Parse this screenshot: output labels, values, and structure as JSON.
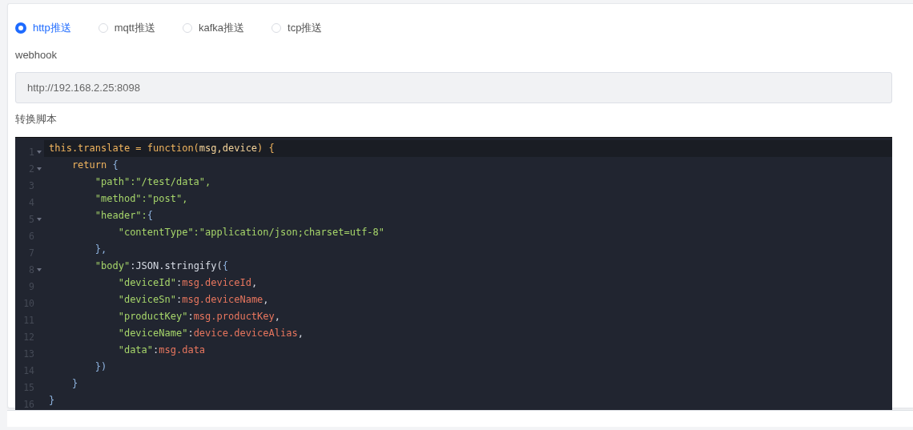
{
  "push_types": [
    {
      "label": "http推送",
      "selected": true
    },
    {
      "label": "mqtt推送",
      "selected": false
    },
    {
      "label": "kafka推送",
      "selected": false
    },
    {
      "label": "tcp推送",
      "selected": false
    }
  ],
  "webhook": {
    "label": "webhook",
    "value": "http://192.168.2.25:8098"
  },
  "script": {
    "label": "转换脚本",
    "lines": [
      {
        "number": "1",
        "foldable": true,
        "active": true,
        "tokens": [
          {
            "kind": "kw",
            "text": "this.translate = function("
          },
          {
            "kind": "arg",
            "text": "msg,device"
          },
          {
            "kind": "kw",
            "text": ") {"
          }
        ]
      },
      {
        "number": "2",
        "foldable": true,
        "active": false,
        "tokens": [
          {
            "kind": "kw",
            "text": "    return "
          },
          {
            "kind": "punc",
            "text": "{"
          }
        ]
      },
      {
        "number": "3",
        "foldable": false,
        "active": false,
        "tokens": [
          {
            "kind": "str",
            "text": "        \"path\":\"/test/data\","
          }
        ]
      },
      {
        "number": "4",
        "foldable": false,
        "active": false,
        "tokens": [
          {
            "kind": "str",
            "text": "        \"method\":\"post\","
          }
        ]
      },
      {
        "number": "5",
        "foldable": true,
        "active": false,
        "tokens": [
          {
            "kind": "str",
            "text": "        \"header\":"
          },
          {
            "kind": "punc",
            "text": "{"
          }
        ]
      },
      {
        "number": "6",
        "foldable": false,
        "active": false,
        "tokens": [
          {
            "kind": "str",
            "text": "            \"contentType\":\"application/json;charset=utf-8\""
          }
        ]
      },
      {
        "number": "7",
        "foldable": false,
        "active": false,
        "tokens": [
          {
            "kind": "punc",
            "text": "        },"
          }
        ]
      },
      {
        "number": "8",
        "foldable": true,
        "active": false,
        "tokens": [
          {
            "kind": "str",
            "text": "        \"body\""
          },
          {
            "kind": "plain",
            "text": ":JSON.stringify("
          },
          {
            "kind": "punc",
            "text": "{"
          }
        ]
      },
      {
        "number": "9",
        "foldable": false,
        "active": false,
        "tokens": [
          {
            "kind": "str",
            "text": "            \"deviceId\""
          },
          {
            "kind": "plain",
            "text": ":"
          },
          {
            "kind": "var",
            "text": "msg.deviceId"
          },
          {
            "kind": "plain",
            "text": ","
          }
        ]
      },
      {
        "number": "10",
        "foldable": false,
        "active": false,
        "tokens": [
          {
            "kind": "str",
            "text": "            \"deviceSn\""
          },
          {
            "kind": "plain",
            "text": ":"
          },
          {
            "kind": "var",
            "text": "msg.deviceName"
          },
          {
            "kind": "plain",
            "text": ","
          }
        ]
      },
      {
        "number": "11",
        "foldable": false,
        "active": false,
        "tokens": [
          {
            "kind": "str",
            "text": "            \"productKey\""
          },
          {
            "kind": "plain",
            "text": ":"
          },
          {
            "kind": "var",
            "text": "msg.productKey"
          },
          {
            "kind": "plain",
            "text": ","
          }
        ]
      },
      {
        "number": "12",
        "foldable": false,
        "active": false,
        "tokens": [
          {
            "kind": "str",
            "text": "            \"deviceName\""
          },
          {
            "kind": "plain",
            "text": ":"
          },
          {
            "kind": "var",
            "text": "device.deviceAlias"
          },
          {
            "kind": "plain",
            "text": ","
          }
        ]
      },
      {
        "number": "13",
        "foldable": false,
        "active": false,
        "tokens": [
          {
            "kind": "str",
            "text": "            \"data\""
          },
          {
            "kind": "plain",
            "text": ":"
          },
          {
            "kind": "var",
            "text": "msg.data"
          }
        ]
      },
      {
        "number": "14",
        "foldable": false,
        "active": false,
        "tokens": [
          {
            "kind": "punc",
            "text": "        })"
          }
        ]
      },
      {
        "number": "15",
        "foldable": false,
        "active": false,
        "tokens": [
          {
            "kind": "punc",
            "text": "    }"
          }
        ]
      },
      {
        "number": "16",
        "foldable": false,
        "active": false,
        "tokens": [
          {
            "kind": "punc",
            "text": "}"
          }
        ]
      }
    ]
  }
}
